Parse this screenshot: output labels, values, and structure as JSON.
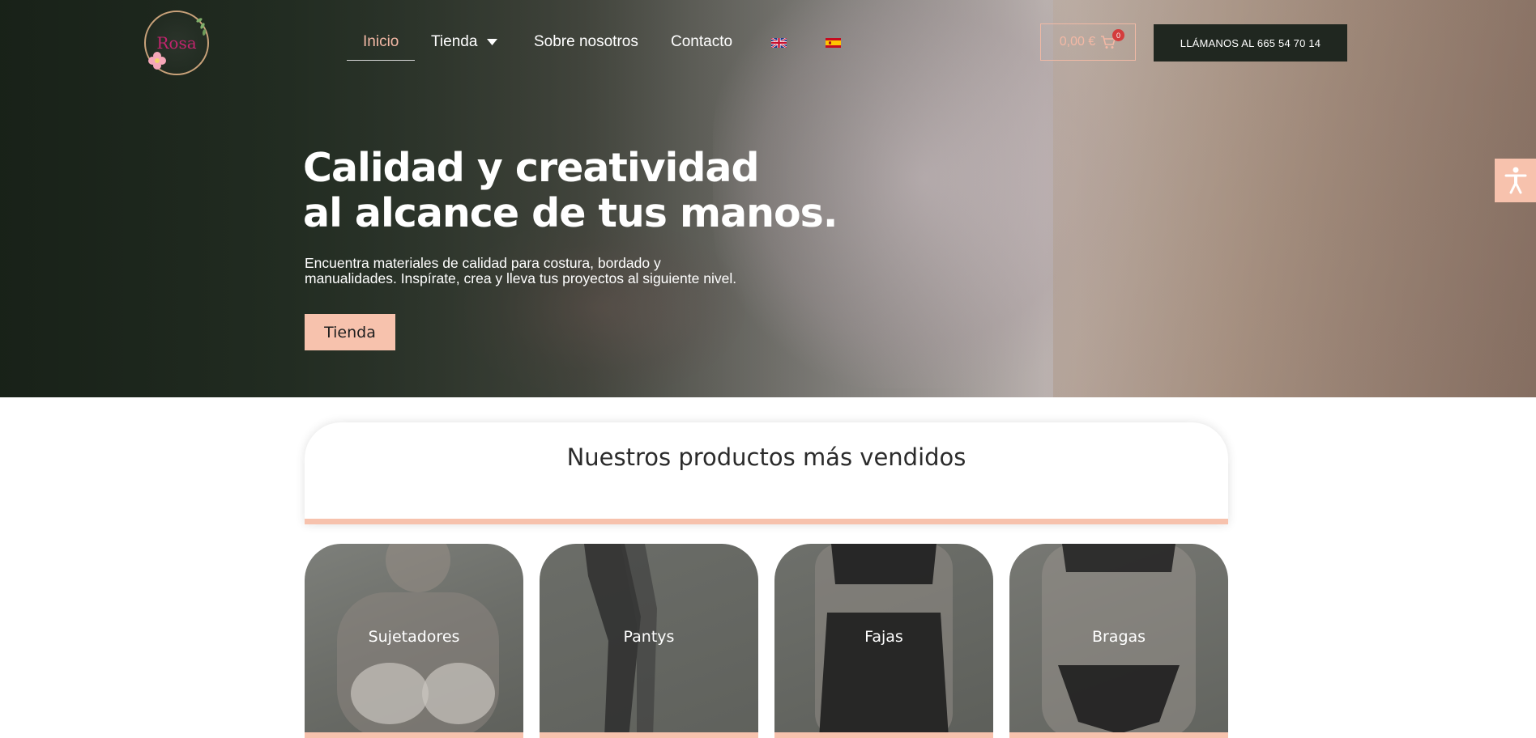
{
  "header": {
    "logo_text": "Rosa",
    "nav": [
      {
        "label": "Inicio",
        "active": true
      },
      {
        "label": "Tienda",
        "has_dropdown": true
      },
      {
        "label": "Sobre nosotros"
      },
      {
        "label": "Contacto"
      }
    ],
    "languages": [
      "en",
      "es"
    ],
    "cart": {
      "amount": "0,00 €",
      "count": "0"
    },
    "call_button": "LLÁMANOS AL 665 54 70 14"
  },
  "hero": {
    "title_line1": "Calidad y creatividad",
    "title_line2": "al alcance de tus manos.",
    "subtitle_line1": "Encuentra materiales de calidad para costura, bordado y",
    "subtitle_line2": "manualidades. Inspírate, crea y lleva tus proyectos al siguiente nivel.",
    "button": "Tienda"
  },
  "bestsellers": {
    "title": "Nuestros productos más vendidos",
    "categories": [
      {
        "label": "Sujetadores"
      },
      {
        "label": "Pantys"
      },
      {
        "label": "Fajas"
      },
      {
        "label": "Bragas"
      }
    ]
  },
  "colors": {
    "accent": "#f7c2ad",
    "dark": "#202720",
    "badge": "#d43c3c",
    "logo_pink": "#c2246e"
  },
  "icons": {
    "cart": "cart-icon",
    "accessibility": "accessibility-icon",
    "dropdown": "chevron-down-icon"
  }
}
